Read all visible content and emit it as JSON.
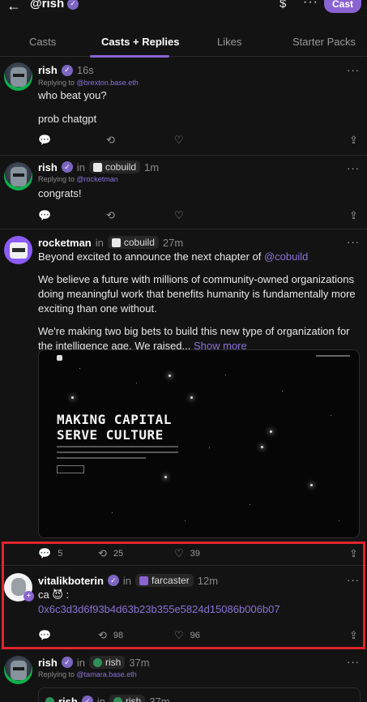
{
  "header": {
    "back_icon": "back-arrow-icon",
    "handle": "@rish",
    "currency_icon": "$",
    "more": "···",
    "cast_button": "Cast"
  },
  "tabs": [
    "Casts",
    "Casts + Replies",
    "Likes",
    "Starter Packs"
  ],
  "active_tab": "Casts + Replies",
  "icons": {
    "reply": "reply-icon",
    "recast": "recast-icon",
    "like": "heart-icon",
    "share": "share-icon",
    "verified": "verified-badge-icon"
  },
  "casts": [
    {
      "author": "rish",
      "time": "16s",
      "reply_prefix": "Replying to",
      "reply_to": "@brexton.base.eth",
      "line1": "who beat you?",
      "line2": "prob chatgpt"
    },
    {
      "author": "rish",
      "in": "in",
      "channel": "cobuild",
      "time": "1m",
      "reply_prefix": "Replying to",
      "reply_to": "@rocketman",
      "line1": "congrats!"
    },
    {
      "author": "rocketman",
      "in": "in",
      "channel": "cobuild",
      "time": "27m",
      "p1_text": "Beyond excited to announce the next chapter of ",
      "p1_mention": "@cobuild",
      "p2": "We believe a future with millions of community-owned organizations doing meaningful work that benefits humanity is fundamentally more exciting than one without.",
      "p3_text": "We're making two big bets to build this new type of organization for the intelligence age. We raised...",
      "p3_more": " Show more",
      "media_headline_1": "MAKING CAPITAL",
      "media_headline_2": "SERVE CULTURE",
      "replies": "5",
      "recasts": "25",
      "likes": "39"
    },
    {
      "author": "vitalikbot",
      "author_suffix": "erin",
      "in": "in",
      "channel": "farcaster",
      "time": "12m",
      "line1": "ca 😈 :",
      "address": "0x6c3d3d6f93b4d63b23b355e5824d15086b006b07",
      "recasts": "98",
      "likes": "96"
    },
    {
      "author": "rish",
      "in": "in",
      "channel": "rish",
      "time": "37m",
      "reply_prefix": "Replying to",
      "reply_to": "@tamara.base.eth",
      "quote_author": "rish",
      "quote_in": "in",
      "quote_channel": "rish",
      "quote_time": "37m"
    }
  ]
}
